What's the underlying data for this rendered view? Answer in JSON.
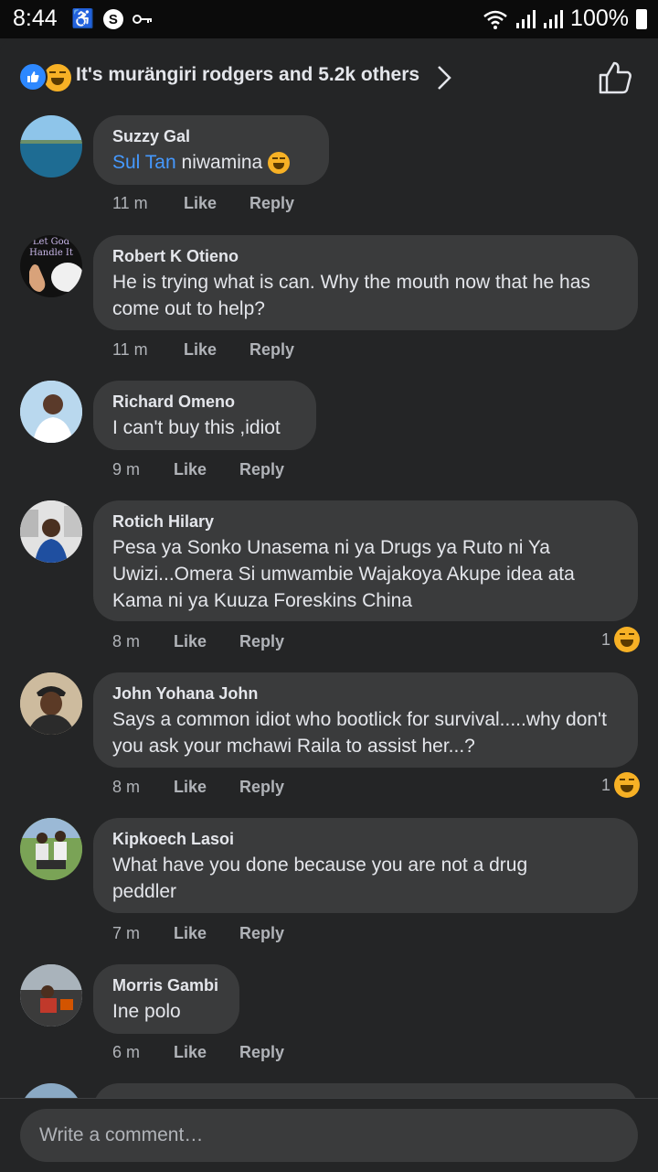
{
  "status": {
    "time": "8:44",
    "battery": "100%"
  },
  "header": {
    "reactors": "It's murängiri rodgers and 5.2k others"
  },
  "comments": [
    {
      "author": "Suzzy Gal",
      "mention": "Sul Tan",
      "text": "niwamina",
      "time": "11 m",
      "like": "Like",
      "reply": "Reply"
    },
    {
      "author": "Robert K Otieno",
      "avatar_caption_1": "Let God",
      "avatar_caption_2": "Handle It",
      "text": "He is trying what is can. Why the mouth now that he has come out to help?",
      "time": "11 m",
      "like": "Like",
      "reply": "Reply"
    },
    {
      "author": "Richard Omeno",
      "text": "I can't buy this ,idiot",
      "time": "9 m",
      "like": "Like",
      "reply": "Reply"
    },
    {
      "author": "Rotich Hilary",
      "text": "Pesa ya Sonko Unasema ni ya Drugs ya Ruto ni Ya Uwizi...Omera Si umwambie Wajakoya Akupe idea ata Kama ni ya Kuuza Foreskins China",
      "time": "8 m",
      "like": "Like",
      "reply": "Reply",
      "reactions": "1"
    },
    {
      "author": "John Yohana John",
      "text": "Says a common idiot who bootlick for survival.....why don't you ask your mchawi Raila to assist her...?",
      "time": "8 m",
      "like": "Like",
      "reply": "Reply",
      "reactions": "1"
    },
    {
      "author": "Kipkoech Lasoi",
      "text": "What have you done because you are not a drug peddler",
      "time": "7 m",
      "like": "Like",
      "reply": "Reply"
    },
    {
      "author": "Morris Gambi",
      "text": "Ine polo",
      "time": "6 m",
      "like": "Like",
      "reply": "Reply"
    }
  ],
  "composer": {
    "placeholder": "Write a comment…"
  },
  "colors": {
    "background": "#242526",
    "bubble": "#3a3b3c",
    "mention": "#4599ff",
    "like_reaction": "#2d88ff",
    "haha_reaction": "#f7b125"
  }
}
